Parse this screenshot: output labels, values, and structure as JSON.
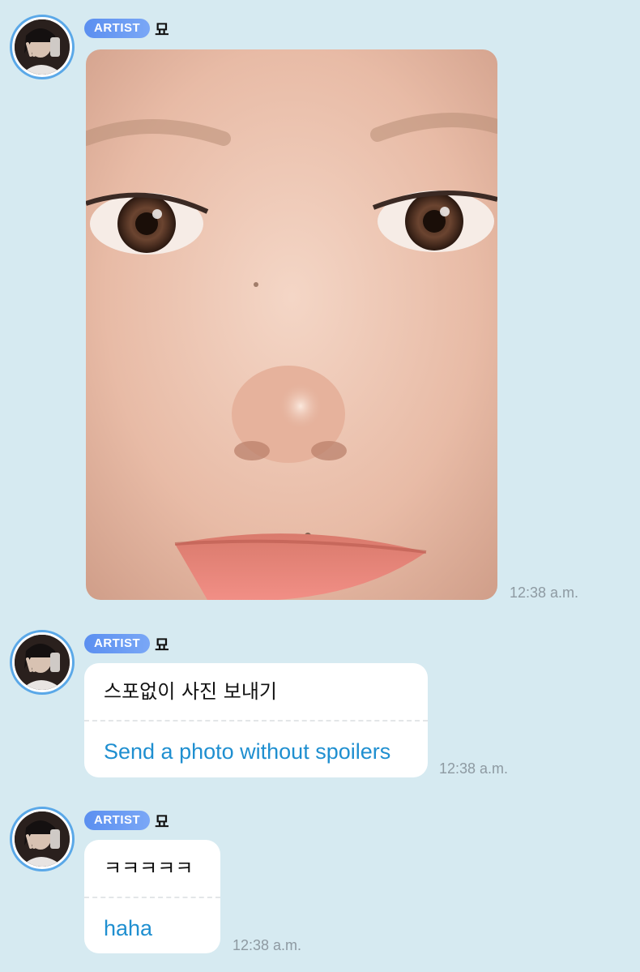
{
  "messages": [
    {
      "badge": "ARTIST",
      "sender": "묘",
      "type": "photo",
      "photo_alt": "close-up face photo",
      "time": "12:38 a.m."
    },
    {
      "badge": "ARTIST",
      "sender": "묘",
      "type": "text",
      "original": "스포없이 사진 보내기",
      "translation": "Send a photo without spoilers",
      "time": "12:38 a.m."
    },
    {
      "badge": "ARTIST",
      "sender": "묘",
      "type": "text",
      "original": "ㅋㅋㅋㅋㅋ",
      "translation": "haha",
      "time": "12:38 a.m."
    }
  ],
  "colors": {
    "background": "#d6eaf1",
    "badge": "#5b8ff0",
    "translation_text": "#1f8fd0",
    "avatar_ring": "#5aa8e8",
    "timestamp": "#8e9aa2"
  }
}
